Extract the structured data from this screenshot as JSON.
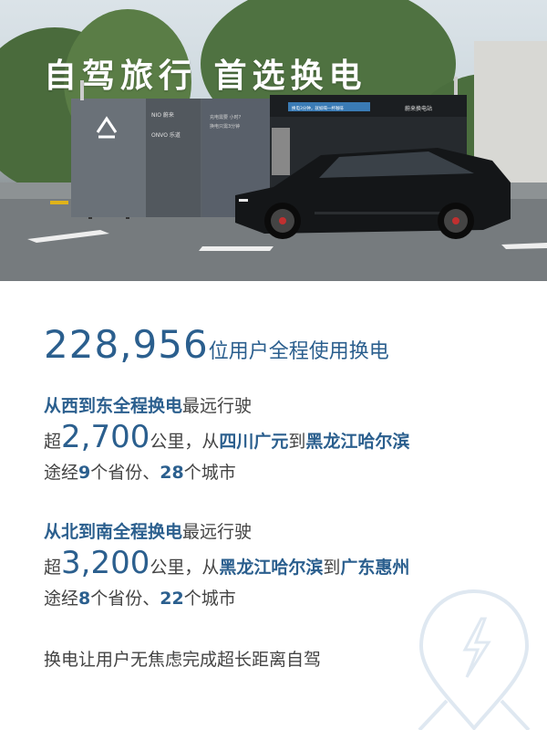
{
  "hero": {
    "title": "自驾旅行 首选换电",
    "station": {
      "brand_nio": "NIO 蔚来",
      "brand_onvo": "ONVO 乐道",
      "screen_line1": "换电3分钟，就如喝一杯咖啡",
      "screen_line2": "蔚来换电站",
      "panel_line1": "充电需要 小时?",
      "panel_line2": "换电只需3分钟"
    }
  },
  "stats": {
    "users_number": "228,956",
    "users_text": "位用户全程使用换电"
  },
  "west_east": {
    "heading_bold": "从西到东全程换电",
    "heading_rest": "最远行驶",
    "prefix": "超",
    "distance": "2,700",
    "unit_from": "公里，从",
    "from": "四川广元",
    "to_word": "到",
    "to": "黑龙江哈尔滨",
    "via_prefix": "途经",
    "provinces": "9",
    "provinces_word": "个省份、",
    "cities": "28",
    "cities_word": "个城市"
  },
  "north_south": {
    "heading_bold": "从北到南全程换电",
    "heading_rest": "最远行驶",
    "prefix": "超",
    "distance": "3,200",
    "unit_from": "公里，从",
    "from": "黑龙江哈尔滨",
    "to_word": "到",
    "to": "广东惠州",
    "via_prefix": "途经",
    "provinces": "8",
    "provinces_word": "个省份、",
    "cities": "22",
    "cities_word": "个城市"
  },
  "footer_text": "换电让用户无焦虑完成超长距离自驾",
  "colors": {
    "accent": "#2b5f8e",
    "body_text": "#444444",
    "station_body": "#5b6269",
    "car": "#141618"
  },
  "icons": [
    "nio-logo-icon",
    "lightning-location-icon"
  ]
}
